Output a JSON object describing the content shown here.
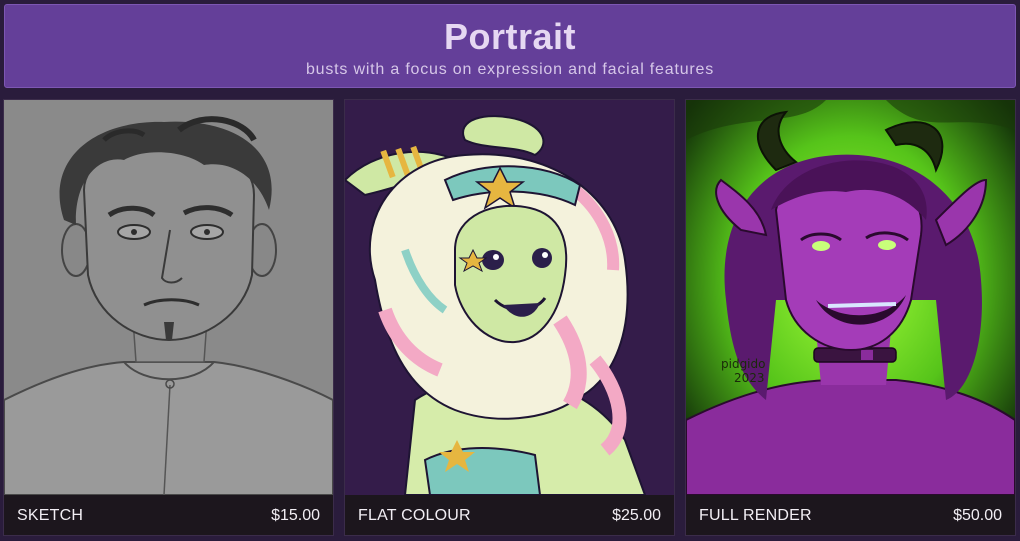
{
  "header": {
    "title": "Portrait",
    "subtitle": "busts with a focus on expression and facial features"
  },
  "cards": [
    {
      "name": "SKETCH",
      "price": "$15.00",
      "style": "grayscale sketch"
    },
    {
      "name": "FLAT COLOUR",
      "price": "$25.00",
      "style": "flat colour"
    },
    {
      "name": "FULL RENDER",
      "price": "$50.00",
      "style": "full render"
    }
  ],
  "colors": {
    "background": "#2a1c3c",
    "header": "#643f99",
    "footer": "#1c161d",
    "text": "#f2eef4"
  }
}
